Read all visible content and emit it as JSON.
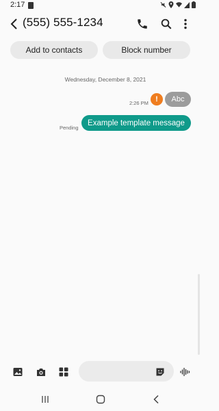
{
  "status_bar": {
    "time": "2:17",
    "icons": [
      "notification-icon",
      "mute-icon",
      "location-icon",
      "wifi-icon",
      "signal-icon",
      "battery-icon"
    ]
  },
  "app_bar": {
    "contact_number": "(555) 555-1234",
    "icons": [
      "back-arrow-icon",
      "call-icon",
      "search-icon",
      "more-vert-icon"
    ]
  },
  "actions": {
    "add_to_contacts": "Add to contacts",
    "block_number": "Block number"
  },
  "conversation": {
    "date_separator": "Wednesday, December 8, 2021",
    "messages": [
      {
        "text": "Abc",
        "time": "2:26 PM",
        "status_icon": "!",
        "bubble_color": "#9c9c9c"
      },
      {
        "text": "Example template message",
        "status": "Pending",
        "bubble_color": "#0f9a8a"
      }
    ]
  },
  "composer": {
    "input_placeholder": "",
    "icons": [
      "gallery-icon",
      "camera-icon",
      "apps-grid-icon",
      "sticker-icon",
      "voice-icon"
    ]
  },
  "nav_bar": {
    "icons": [
      "recents-icon",
      "home-icon",
      "back-icon"
    ]
  },
  "colors": {
    "background": "#fafafa",
    "accent": "#0f9a8a",
    "error": "#ef7d1f",
    "pill": "#e9e9e9"
  }
}
